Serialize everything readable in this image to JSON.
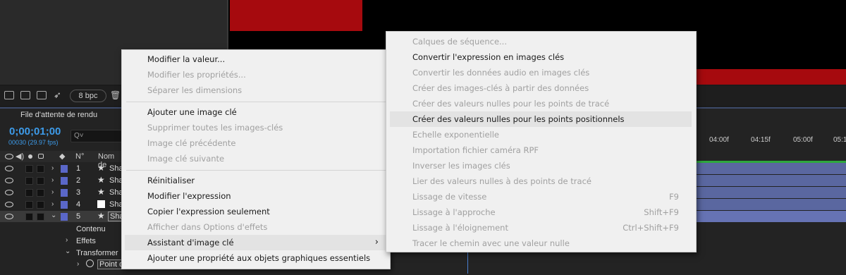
{
  "toolbar": {
    "bpc_label": "8 bpc"
  },
  "timeline": {
    "render_queue_tab": "File d'attente de rendu",
    "timecode": "0;00;01;00",
    "frames": "00030 (29.97 fps)",
    "search_placeholder": "Q˅",
    "col_number": "N°",
    "col_name": "Nom de",
    "layers": [
      {
        "num": "1",
        "name": "Sha",
        "color": "#5a67c8",
        "type": "shape"
      },
      {
        "num": "2",
        "name": "Sha",
        "color": "#5a67c8",
        "type": "shape"
      },
      {
        "num": "3",
        "name": "Sha",
        "color": "#5a67c8",
        "type": "shape"
      },
      {
        "num": "4",
        "name": "Sha",
        "color": "#5a67c8",
        "type": "solid"
      },
      {
        "num": "5",
        "name": "Sha",
        "color": "#5a67c8",
        "type": "shape"
      }
    ],
    "props": {
      "contents": "Contenu",
      "effects": "Effets",
      "transform": "Transformer",
      "point": "Point d"
    },
    "ruler_ticks": [
      "04:00f",
      "04:15f",
      "05:00f",
      "05:1"
    ]
  },
  "context_menu": {
    "items": [
      {
        "label": "Modifier la valeur...",
        "enabled": true
      },
      {
        "label": "Modifier les propriétés...",
        "enabled": false
      },
      {
        "label": "Séparer les dimensions",
        "enabled": false
      },
      {
        "label": "Ajouter une image clé",
        "enabled": true
      },
      {
        "label": "Supprimer toutes les images-clés",
        "enabled": false
      },
      {
        "label": "Image clé précédente",
        "enabled": false
      },
      {
        "label": "Image clé suivante",
        "enabled": false
      },
      {
        "label": "Réinitialiser",
        "enabled": true
      },
      {
        "label": "Modifier l'expression",
        "enabled": true
      },
      {
        "label": "Copier l'expression seulement",
        "enabled": true
      },
      {
        "label": "Afficher dans Options d'effets",
        "enabled": false
      },
      {
        "label": "Assistant d'image clé",
        "enabled": true,
        "submenu": true
      },
      {
        "label": "Ajouter une propriété aux objets graphiques essentiels",
        "enabled": true
      }
    ],
    "submenu_arrow": "›"
  },
  "submenu": {
    "items": [
      {
        "label": "Calques de séquence...",
        "enabled": false,
        "shortcut": ""
      },
      {
        "label": "Convertir l'expression en images clés",
        "enabled": true,
        "shortcut": ""
      },
      {
        "label": "Convertir les données audio en images clés",
        "enabled": false,
        "shortcut": ""
      },
      {
        "label": "Créer des images-clés à partir des données",
        "enabled": false,
        "shortcut": ""
      },
      {
        "label": "Créer des valeurs nulles pour les points de tracé",
        "enabled": false,
        "shortcut": ""
      },
      {
        "label": "Créer des valeurs nulles pour les points positionnels",
        "enabled": true,
        "shortcut": ""
      },
      {
        "label": "Echelle exponentielle",
        "enabled": false,
        "shortcut": ""
      },
      {
        "label": "Importation fichier caméra RPF",
        "enabled": false,
        "shortcut": ""
      },
      {
        "label": "Inverser les images clés",
        "enabled": false,
        "shortcut": ""
      },
      {
        "label": "Lier des valeurs nulles à des points de tracé",
        "enabled": false,
        "shortcut": ""
      },
      {
        "label": "Lissage de vitesse",
        "enabled": false,
        "shortcut": "F9"
      },
      {
        "label": "Lissage à l'approche",
        "enabled": false,
        "shortcut": "Shift+F9"
      },
      {
        "label": "Lissage à l'éloignement",
        "enabled": false,
        "shortcut": "Ctrl+Shift+F9"
      },
      {
        "label": "Tracer le chemin avec une valeur nulle",
        "enabled": false,
        "shortcut": ""
      }
    ]
  },
  "colors": {
    "composition_red": "#a60a0e",
    "timecode_blue": "#3d9be9",
    "layer_bar": "#5a67a0",
    "work_area_green": "#2ea83e"
  }
}
